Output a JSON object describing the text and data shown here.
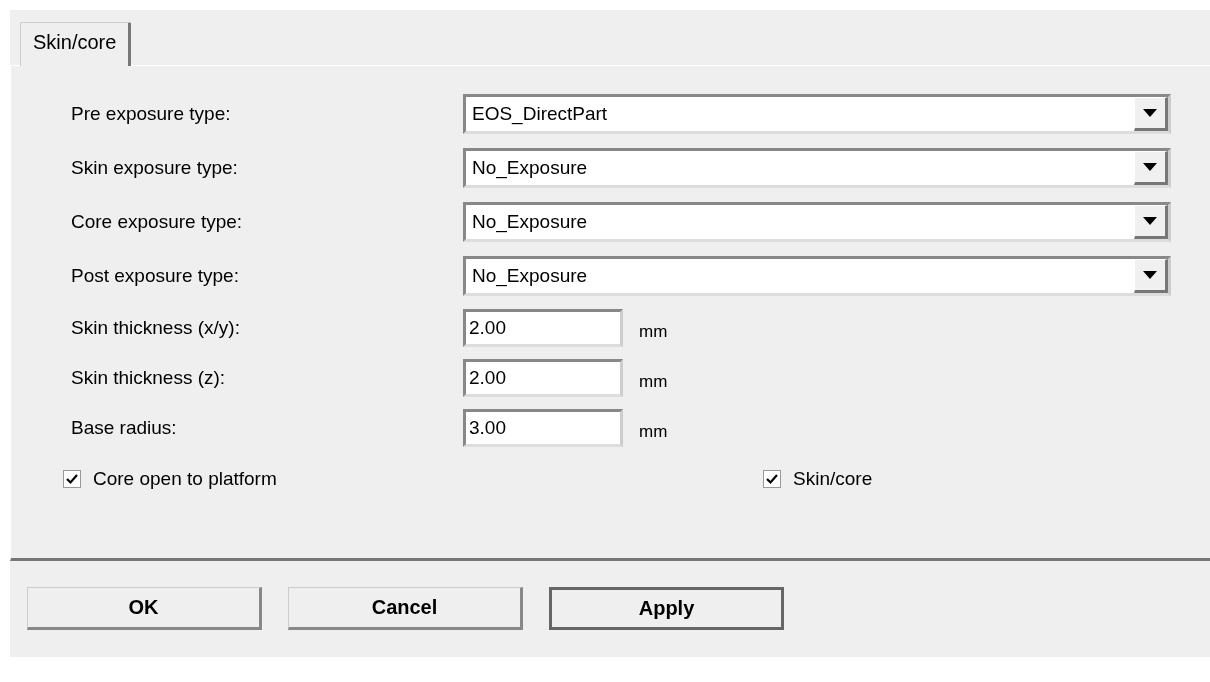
{
  "tabs": [
    {
      "label": "Skin/core",
      "selected": true
    }
  ],
  "dropdowns": [
    {
      "label": "Pre exposure type:",
      "value": "EOS_DirectPart"
    },
    {
      "label": "Skin exposure type:",
      "value": "No_Exposure"
    },
    {
      "label": "Core exposure type:",
      "value": "No_Exposure"
    },
    {
      "label": "Post exposure type:",
      "value": "No_Exposure"
    }
  ],
  "fields": [
    {
      "label": "Skin thickness (x/y):",
      "value": "2.00",
      "unit": "mm"
    },
    {
      "label": "Skin thickness (z):",
      "value": "2.00",
      "unit": "mm"
    },
    {
      "label": "Base radius:",
      "value": "3.00",
      "unit": "mm"
    }
  ],
  "checkboxes": [
    {
      "label": "Core open to platform",
      "checked": true
    },
    {
      "label": "Skin/core",
      "checked": true
    }
  ],
  "buttons": [
    {
      "label": "OK",
      "default": false
    },
    {
      "label": "Cancel",
      "default": false
    },
    {
      "label": "Apply",
      "default": true
    }
  ]
}
